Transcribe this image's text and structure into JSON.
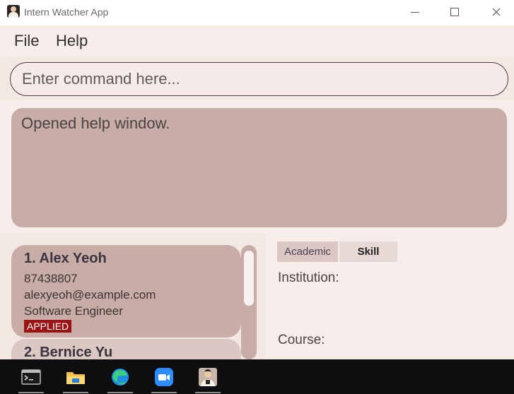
{
  "window": {
    "title": "Intern Watcher App"
  },
  "menu": {
    "file": "File",
    "help": "Help"
  },
  "command": {
    "placeholder": "Enter command here..."
  },
  "result": {
    "text": "Opened help window."
  },
  "applicants": [
    {
      "name": "1.  Alex Yeoh",
      "phone": "87438807",
      "email": "alexyeoh@example.com",
      "role": "Software Engineer",
      "status": "APPLIED"
    },
    {
      "name": "2.  Bernice Yu"
    }
  ],
  "detail": {
    "tabs": [
      "Academic",
      "Skill"
    ],
    "active_tab": "Skill",
    "institution_label": "Institution:",
    "course_label": "Course:"
  },
  "colors": {
    "accent_card": "#c8ada7",
    "status_tag": "#9b1212",
    "background": "#f7eeec"
  },
  "taskbar": {
    "icons": [
      "terminal-icon",
      "file-explorer-icon",
      "edge-browser-icon",
      "zoom-icon",
      "intern-watcher-icon"
    ]
  }
}
